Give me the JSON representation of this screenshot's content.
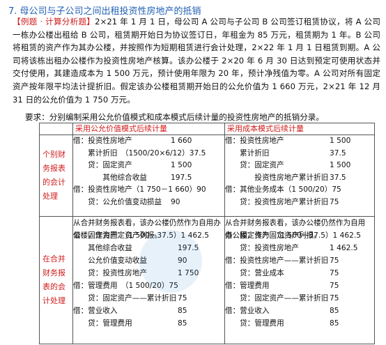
{
  "title": "7. 母公司与子公司之间出租投资性房地产的抵销",
  "intro": {
    "tag": "【例题 · 计算分析题】",
    "text": "2×21 年 1 月 1 日，母公司 A 公司与子公司 B 公司签订租赁协议，将 A 公司一栋办公楼出租给 B 公司，租赁期开始日为协议签订日，年租金为 85 万元，租赁期为 1 年。B 公司将租赁的资产作为其办公楼，并按照作为短期租赁进行会计处理，2×22 年 1 月 1 日租赁到期。A 公司将该栋出租办公楼作为投资性房地产核算。该办公楼于 2×20 年 6 月 30 日达到预定可使用状态并交付使用，其建造成本为 1 500 万元，预计使用年限为 20 年，预计净残值为零。A 公司对所有固定资产按年限平均法计提折旧。假定该办公楼租赁期开始日的公允价值为 1 660 万元，2×21 年 12 月 31 日的公允价值为 1 750 万元。"
  },
  "requirement": "要求：分别编制采用公允价值模式和成本模式后续计量的投资性房地产的抵销分录。",
  "table": {
    "head_fair": "采用公允价值模式后续计量",
    "head_cost": "采用成本模式后续计量",
    "row1_label": "个别财务报表的会计处理",
    "row2_label": "在合并财务报表的会计处理",
    "r1_fair": [
      {
        "t": "借：投资性房地产",
        "v": "1 660"
      },
      {
        "t": "　　累计折旧　（1500/20×6/12）37.5",
        "v": ""
      },
      {
        "t": "　　贷：固定资产",
        "v": "1 500"
      },
      {
        "t": "　　　　其他综合收益",
        "v": "197.5"
      },
      {
        "t": "借：投资性房地产（1 750－1 660）90",
        "v": ""
      },
      {
        "t": "　　贷：公允价值变动损益",
        "v": "90"
      }
    ],
    "r1_cost": [
      {
        "t": "借：投资性房地产",
        "v": "1 500"
      },
      {
        "t": "　　累计折旧",
        "v": "37.5"
      },
      {
        "t": "　　贷：固定资产",
        "v": "1 500"
      },
      {
        "t": "　　　　投资性房地产累计折旧",
        "v": "37.5"
      },
      {
        "t": "借：其他业务成本（1 500/20）75",
        "v": ""
      },
      {
        "t": "　　贷：投资性房地产累计折旧",
        "v": "75"
      }
    ],
    "r2_fair_intro": "从合并财务报表看，该办公楼仍然作为自用办公楼，作为固定资产列报。",
    "r2_fair": [
      {
        "t": "借：固定资产　（1 500－37.5）1 462.5",
        "v": ""
      },
      {
        "t": "　　其他综合收益",
        "v": "197.5"
      },
      {
        "t": "　　公允价值变动收益",
        "v": "90"
      },
      {
        "t": "　　贷：投资性房地产",
        "v": "1 750"
      },
      {
        "t": "借：管理费用　（1 500/20）75",
        "v": ""
      },
      {
        "t": "　　贷：固定资产——累计折旧",
        "v": "75"
      },
      {
        "t": "借：营业收入",
        "v": "85"
      },
      {
        "t": "　　贷：管理费用",
        "v": "85"
      }
    ],
    "r2_cost_intro": "从合并财务报表看，该办公楼仍然作为自用办公楼，作为固定资产列报。",
    "r2_cost": [
      {
        "t": "借：固定资产　（1 500－37.5）1 462.5",
        "v": ""
      },
      {
        "t": "　　贷：投资性房地产",
        "v": "1 462.5"
      },
      {
        "t": "借：投资性房地产——累计折旧",
        "v": "75"
      },
      {
        "t": "　　贷：营业成本",
        "v": "75"
      },
      {
        "t": "借：管理费用",
        "v": "75"
      },
      {
        "t": "　　贷：固定资产——累计折旧",
        "v": "75"
      },
      {
        "t": "借：营业收入",
        "v": "85"
      },
      {
        "t": "　　贷：管理费用",
        "v": "85"
      }
    ]
  }
}
